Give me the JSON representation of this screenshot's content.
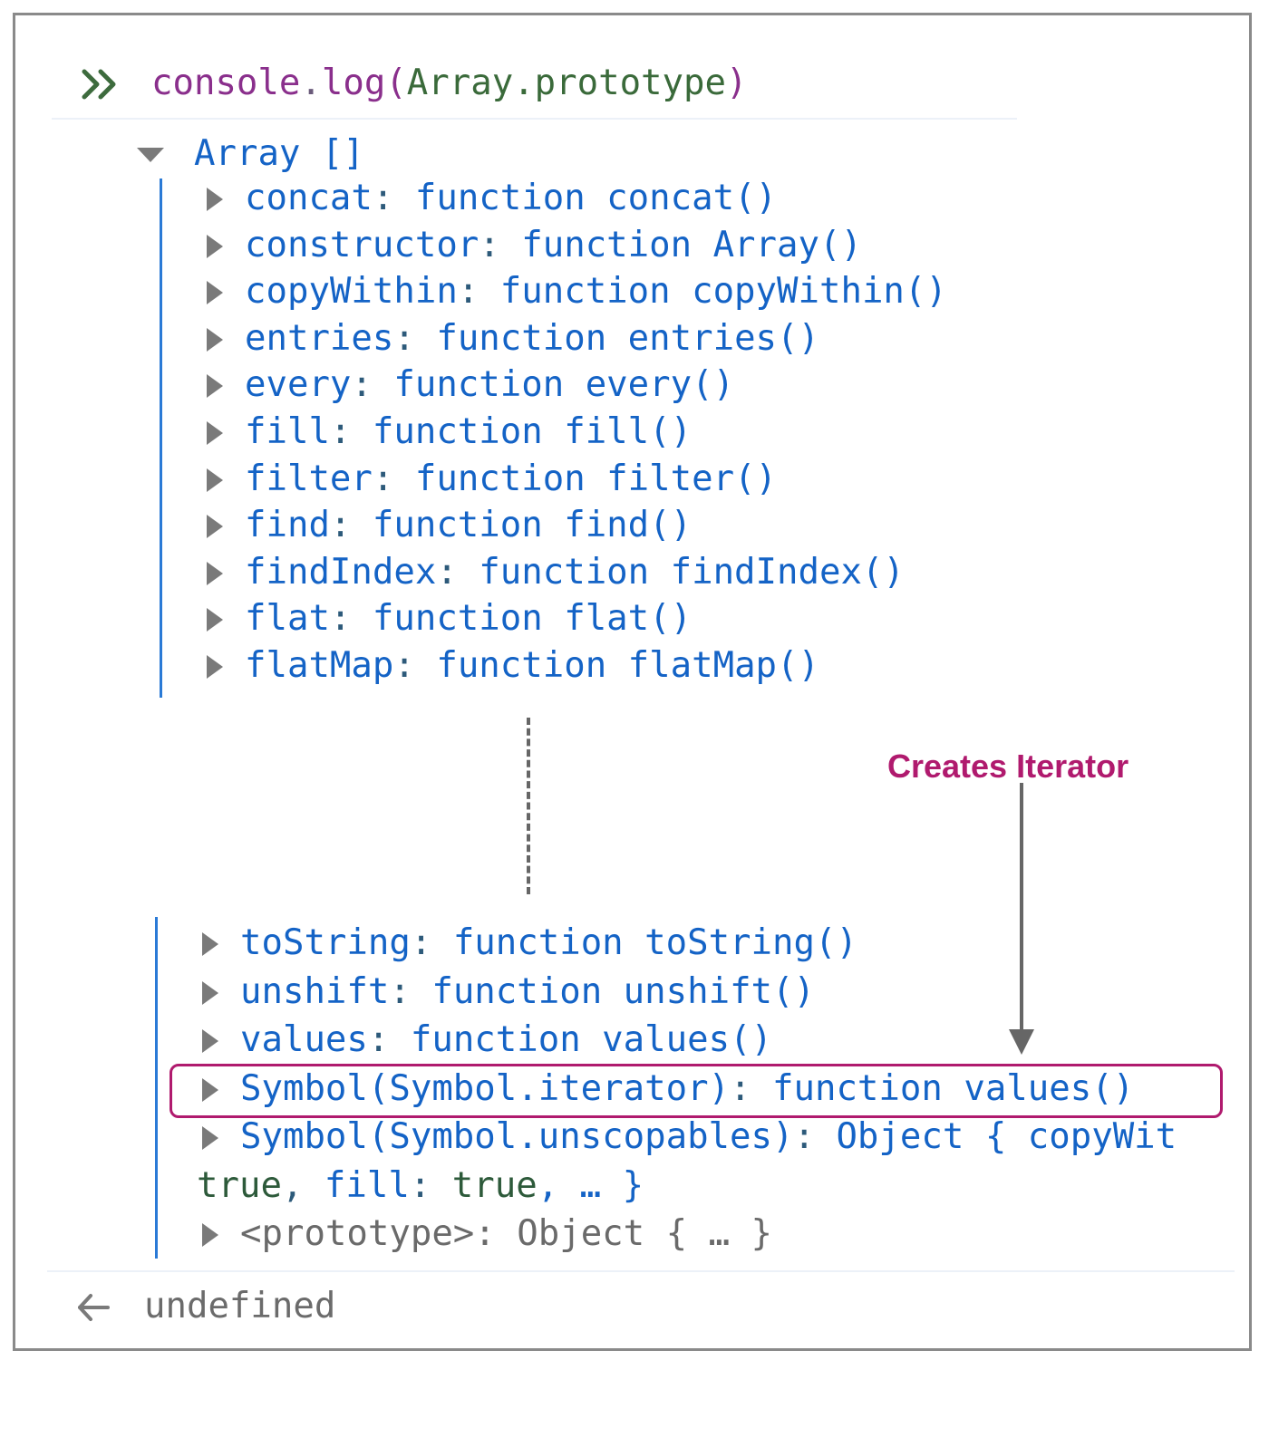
{
  "input": {
    "fn": "console",
    "dot1": ".",
    "method": "log(",
    "arg": "Array.prototype",
    "close": ")"
  },
  "array_label": "Array []",
  "top_props": [
    {
      "key": "concat",
      "val": "function concat()"
    },
    {
      "key": "constructor",
      "val": "function Array()"
    },
    {
      "key": "copyWithin",
      "val": "function copyWithin()"
    },
    {
      "key": "entries",
      "val": "function entries()"
    },
    {
      "key": "every",
      "val": "function every()"
    },
    {
      "key": "fill",
      "val": "function fill()"
    },
    {
      "key": "filter",
      "val": "function filter()"
    },
    {
      "key": "find",
      "val": "function find()"
    },
    {
      "key": "findIndex",
      "val": "function findIndex()"
    },
    {
      "key": "flat",
      "val": "function flat()"
    },
    {
      "key": "flatMap",
      "val": "function flatMap()"
    }
  ],
  "bottom_props": [
    {
      "key": "toString",
      "val": "function toString()"
    },
    {
      "key": "unshift",
      "val": "function unshift()"
    },
    {
      "key": "values",
      "val": "function values()"
    },
    {
      "key": "Symbol(Symbol.iterator)",
      "val": "function values()"
    }
  ],
  "unscopables": {
    "key": "Symbol(Symbol.unscopables)",
    "val_start": "Object { copyWit",
    "line2_a": "true",
    "line2_b": ", ",
    "line2_c": "fill",
    "line2_d": ": ",
    "line2_e": "true",
    "line2_f": ", … }"
  },
  "prototype": {
    "key": "<prototype>",
    "val": "Object { … }"
  },
  "annotation": "Creates Iterator",
  "result": "undefined"
}
